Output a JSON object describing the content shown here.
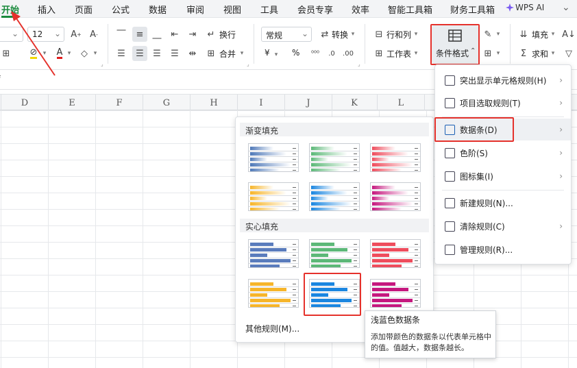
{
  "tabs": [
    {
      "label": "开始",
      "active": true
    },
    {
      "label": "插入"
    },
    {
      "label": "页面"
    },
    {
      "label": "公式"
    },
    {
      "label": "数据"
    },
    {
      "label": "审阅"
    },
    {
      "label": "视图"
    },
    {
      "label": "工具"
    },
    {
      "label": "会员专享"
    },
    {
      "label": "效率"
    },
    {
      "label": "智能工具箱"
    },
    {
      "label": "财务工具箱"
    }
  ],
  "wps_ai": "WPS AI",
  "ribbon": {
    "font_size": "12",
    "number_format": "常规",
    "wrap_text": "换行",
    "convert": "转换",
    "merge": "合并",
    "row_col": "行和列",
    "worksheet": "工作表",
    "conditional_format": "条件格式",
    "fill": "填充",
    "sum": "求和",
    "currency": "¥",
    "percent": "%"
  },
  "columns": [
    "D",
    "E",
    "F",
    "G",
    "H",
    "I",
    "J",
    "K",
    "L"
  ],
  "cf_menu": [
    {
      "label": "突出显示单元格规则(H)",
      "submenu": true
    },
    {
      "label": "项目选取规则(T)",
      "submenu": true
    },
    {
      "label": "数据条(D)",
      "submenu": true,
      "highlighted": true
    },
    {
      "label": "色阶(S)",
      "submenu": true
    },
    {
      "label": "图标集(I)",
      "submenu": true
    },
    {
      "label": "新建规则(N)...",
      "submenu": false
    },
    {
      "label": "清除规则(C)",
      "submenu": true
    },
    {
      "label": "管理规则(R)...",
      "submenu": false
    }
  ],
  "databar_panel": {
    "gradient_title": "渐变填充",
    "solid_title": "实心填充",
    "other_rules": "其他规则(M)...",
    "gradient_colors": [
      "#4f79b8",
      "#5cb878",
      "#ee4d5d",
      "#f6b52b",
      "#1b86e0",
      "#c5187e"
    ],
    "solid_colors": [
      "#5a7cbc",
      "#5cb878",
      "#ee4d5d",
      "#f6b52b",
      "#1b86e0",
      "#c5187e"
    ]
  },
  "tooltip": {
    "title": "浅蓝色数据条",
    "description": "添加带颜色的数据条以代表单元格中的值。值越大，数据条越长。"
  },
  "accent_colors": {
    "green_tab": "#1a8a3d",
    "highlight_red": "#e5312b"
  }
}
